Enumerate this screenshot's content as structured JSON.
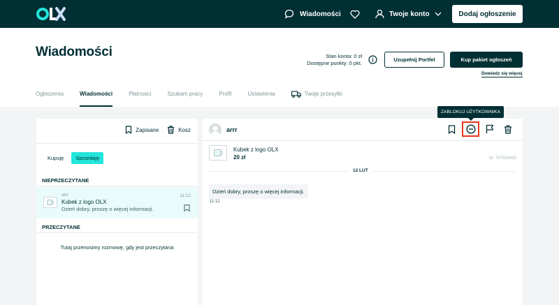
{
  "topbar": {
    "logo_alt": "olx",
    "messages_label": "Wiadomości",
    "account_label": "Twoje konto",
    "add_button": "Dodaj ogłoszenie"
  },
  "header": {
    "title": "Wiadomości",
    "balance_line1": "Stan konta: 0 zł",
    "balance_line2": "Dostępne punkty: 0 pkt.",
    "topup_button": "Uzupełnij Portfel",
    "buy_button": "Kup pakiet ogłoszeń",
    "learn_more": "Dowiedz się więcej"
  },
  "tabs": [
    {
      "label": "Ogłoszenia",
      "active": false
    },
    {
      "label": "Wiadomości",
      "active": true
    },
    {
      "label": "Płatności",
      "active": false
    },
    {
      "label": "Szukam pracy",
      "active": false
    },
    {
      "label": "Profil",
      "active": false
    },
    {
      "label": "Ustawienia",
      "active": false
    },
    {
      "label": "Twoje przesyłki",
      "active": false
    }
  ],
  "left_panel": {
    "saved_label": "Zapisane",
    "trash_label": "Kosz",
    "segment_buy": "Kupuję",
    "segment_sell": "Sprzedaję",
    "unread_header": "NIEPRZECZYTANE",
    "conversation": {
      "user": "arrr",
      "title": "Kubek z logo OLX",
      "text": "Dzień dobry, proszę o więcej informacji.",
      "time": "11:12"
    },
    "read_header": "PRZECZYTANE",
    "empty_note": "Tutaj przenosimy rozmowę, gdy jest przeczytana"
  },
  "chat": {
    "user_name": "arrr",
    "ad_title": "Kubek z logo OLX",
    "ad_price": "20 zł",
    "ad_id": "ID: 747503493",
    "date_label": "12 LUT",
    "message_text": "Dzień dobry, proszę o więcej informacji.",
    "message_time": "11:12",
    "tooltip": "ZABLOKUJ UŻYTKOWNIKA"
  },
  "colors": {
    "brand_dark": "#002f34",
    "accent_teal": "#23e5db",
    "highlight_red": "#e8361c"
  }
}
